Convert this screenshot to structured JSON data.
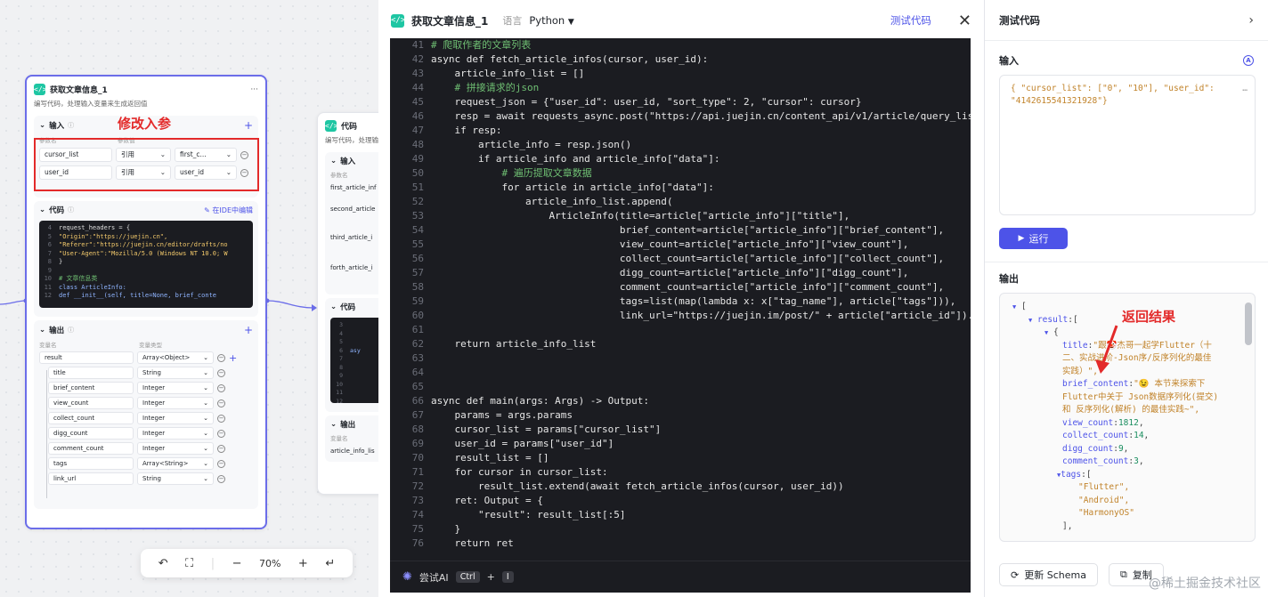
{
  "canvas": {
    "node1": {
      "title": "获取文章信息_1",
      "more": "···",
      "desc": "编写代码，处理输入变量来生成返回值",
      "input_label": "输入",
      "param_name_header": "参数名",
      "param_value_header": "参数值",
      "params": [
        {
          "name": "cursor_list",
          "mode": "引用",
          "value": "first_c..."
        },
        {
          "name": "user_id",
          "mode": "引用",
          "value": "user_id"
        }
      ],
      "code_label": "代码",
      "ide_link": "在IDE中编辑",
      "mini_code": [
        {
          "n": "4",
          "t": "request_headers = {"
        },
        {
          "n": "5",
          "t": "  \"Origin\":\"https://juejin.cn\","
        },
        {
          "n": "6",
          "t": "  \"Referer\":\"https://juejin.cn/editor/drafts/no"
        },
        {
          "n": "7",
          "t": "  \"User-Agent\":\"Mozilla/5.0 (Windows NT 10.0; W"
        },
        {
          "n": "8",
          "t": "}"
        },
        {
          "n": "9",
          "t": ""
        },
        {
          "n": "10",
          "t": "# 文章信息类"
        },
        {
          "n": "11",
          "t": "class ArticleInfo:"
        },
        {
          "n": "12",
          "t": "    def __init__(self, title=None, brief_conte"
        }
      ],
      "output_label": "输出",
      "var_name_header": "变量名",
      "var_type_header": "变量类型",
      "outputs": [
        {
          "name": "result",
          "type": "Array<Object>"
        },
        {
          "name": "title",
          "type": "String"
        },
        {
          "name": "brief_content",
          "type": "Integer"
        },
        {
          "name": "view_count",
          "type": "Integer"
        },
        {
          "name": "collect_count",
          "type": "Integer"
        },
        {
          "name": "digg_count",
          "type": "Integer"
        },
        {
          "name": "comment_count",
          "type": "Integer"
        },
        {
          "name": "tags",
          "type": "Array<String>"
        },
        {
          "name": "link_url",
          "type": "String"
        }
      ]
    },
    "annotation_params": "修改入参",
    "node2": {
      "title": "代码",
      "desc": "编写代码，处理输",
      "input_label": "输入",
      "param_header": "参数名",
      "params": [
        "first_article_inf",
        "second_article",
        "third_article_i",
        "forth_article_i"
      ],
      "code_label": "代码",
      "mini_lines": [
        "3",
        "4",
        "5",
        "6",
        "7",
        "8",
        "9",
        "10",
        "11",
        "12"
      ],
      "mini_code_word": "asy",
      "output_label": "输出",
      "var_header": "变量名",
      "var": "article_info_lis"
    },
    "toolbar": {
      "undo": "↶",
      "fit": "⛶",
      "minus": "−",
      "zoom": "70%",
      "plus": "+",
      "collapse": "↵"
    }
  },
  "editor": {
    "title": "获取文章信息_1",
    "lang_label": "语言",
    "lang": "Python",
    "test_button": "测试代码",
    "close": "✕",
    "lines": [
      {
        "n": "41",
        "t": "# 爬取作者的文章列表"
      },
      {
        "n": "42",
        "t": "async def fetch_article_infos(cursor, user_id):"
      },
      {
        "n": "43",
        "t": "    article_info_list = []"
      },
      {
        "n": "44",
        "t": "    # 拼接请求的json"
      },
      {
        "n": "45",
        "t": "    request_json = {\"user_id\": user_id, \"sort_type\": 2, \"cursor\": cursor}"
      },
      {
        "n": "46",
        "t": "    resp = await requests_async.post(\"https://api.juejin.cn/content_api/v1/article/query_list\", h"
      },
      {
        "n": "47",
        "t": "    if resp:"
      },
      {
        "n": "48",
        "t": "        article_info = resp.json()"
      },
      {
        "n": "49",
        "t": "        if article_info and article_info[\"data\"]:"
      },
      {
        "n": "50",
        "t": "            # 遍历提取文章数据"
      },
      {
        "n": "51",
        "t": "            for article in article_info[\"data\"]:"
      },
      {
        "n": "52",
        "t": "                article_info_list.append("
      },
      {
        "n": "53",
        "t": "                    ArticleInfo(title=article[\"article_info\"][\"title\"],"
      },
      {
        "n": "54",
        "t": "                                brief_content=article[\"article_info\"][\"brief_content\"],"
      },
      {
        "n": "55",
        "t": "                                view_count=article[\"article_info\"][\"view_count\"],"
      },
      {
        "n": "56",
        "t": "                                collect_count=article[\"article_info\"][\"collect_count\"],"
      },
      {
        "n": "57",
        "t": "                                digg_count=article[\"article_info\"][\"digg_count\"],"
      },
      {
        "n": "58",
        "t": "                                comment_count=article[\"article_info\"][\"comment_count\"],"
      },
      {
        "n": "59",
        "t": "                                tags=list(map(lambda x: x[\"tag_name\"], article[\"tags\"])),"
      },
      {
        "n": "60",
        "t": "                                link_url=\"https://juejin.im/post/\" + article[\"article_id\"]).to_js"
      },
      {
        "n": "61",
        "t": ""
      },
      {
        "n": "62",
        "t": "    return article_info_list"
      },
      {
        "n": "63",
        "t": ""
      },
      {
        "n": "64",
        "t": ""
      },
      {
        "n": "65",
        "t": ""
      },
      {
        "n": "66",
        "t": "async def main(args: Args) -> Output:"
      },
      {
        "n": "67",
        "t": "    params = args.params"
      },
      {
        "n": "68",
        "t": "    cursor_list = params[\"cursor_list\"]"
      },
      {
        "n": "69",
        "t": "    user_id = params[\"user_id\"]"
      },
      {
        "n": "70",
        "t": "    result_list = []"
      },
      {
        "n": "71",
        "t": "    for cursor in cursor_list:"
      },
      {
        "n": "72",
        "t": "        result_list.extend(await fetch_article_infos(cursor, user_id))"
      },
      {
        "n": "73",
        "t": "    ret: Output = {"
      },
      {
        "n": "74",
        "t": "        \"result\": result_list[:5]"
      },
      {
        "n": "75",
        "t": "    }"
      },
      {
        "n": "76",
        "t": "    return ret"
      }
    ],
    "footer": {
      "ai_label": "尝试AI",
      "key1": "Ctrl",
      "plus": "+",
      "key2": "I"
    }
  },
  "panel": {
    "title": "测试代码",
    "chevron": "›",
    "input_label": "输入",
    "ai_badge": "A",
    "input_json_1": "{ \"cursor_list\": [\"0\", \"10\"], \"user_id\":",
    "input_json_2": "\"4142615541321928\"}",
    "input_ellipsis": "…",
    "run_button": "运行",
    "output_label": "输出",
    "annotation_result": "返回结果",
    "output_tree": {
      "open_bracket": "[",
      "result_key": "result",
      "open_brace": "{",
      "title_key": "title",
      "title_val_1": "\"跟🤡杰哥一起学Flutter（十",
      "title_val_2": "二、实战进阶-Json序/反序列化的最佳",
      "title_val_3": "实践）\",",
      "brief_key": "brief_content",
      "brief_val_1": "\"😉 本节来探索下",
      "brief_val_2": "Flutter中关于 Json数据序列化(提交)",
      "brief_val_3": "和 反序列化(解析) 的最佳实践~\",",
      "view_key": "view_count",
      "view_val": "1812",
      "collect_key": "collect_count",
      "collect_val": "14",
      "digg_key": "digg_count",
      "digg_val": "9",
      "comment_key": "comment_count",
      "comment_val": "3",
      "tags_key": "tags",
      "tags": [
        "\"Flutter\",",
        "\"Android\",",
        "\"HarmonyOS\""
      ],
      "close_bracket": "],"
    },
    "update_schema": "更新 Schema",
    "copy": "复制"
  },
  "watermark": "@稀土掘金技术社区",
  "colors": {
    "accent": "#4d53e8",
    "annotation": "#e32a2a",
    "code_bg": "#1b1c21",
    "node_icon": "#1ec6a3"
  }
}
